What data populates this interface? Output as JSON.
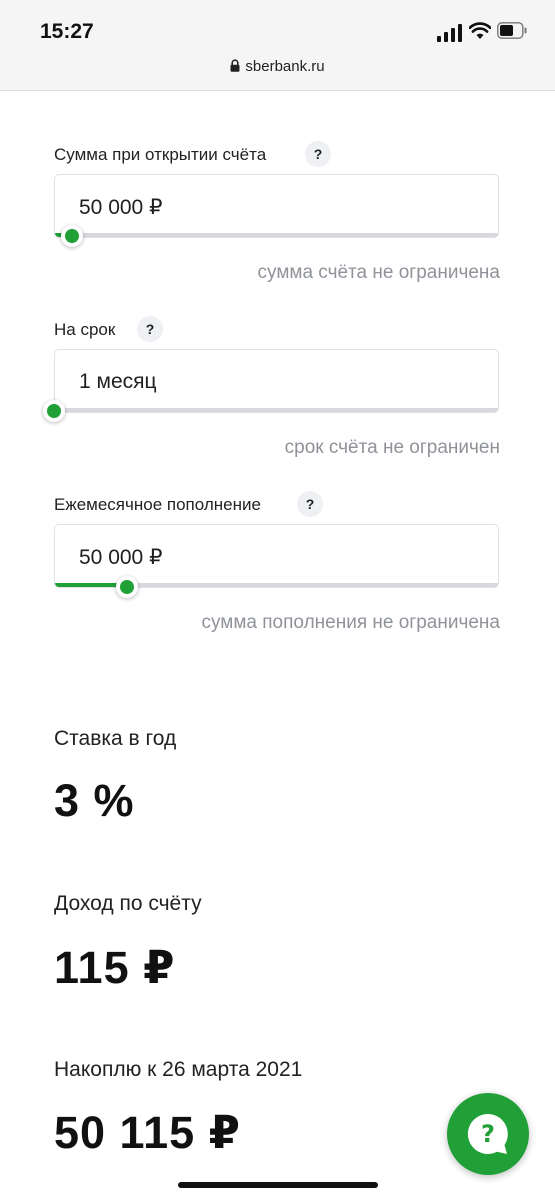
{
  "status_bar": {
    "time": "15:27",
    "url": "sberbank.ru"
  },
  "calculator": {
    "initial_amount": {
      "label": "Сумма при открытии счёта",
      "help": "?",
      "value": "50 000 ₽",
      "hint": "сумма счёта не ограничена",
      "slider_fraction": 0.04
    },
    "term": {
      "label": "На срок",
      "help": "?",
      "value": "1 месяц",
      "hint": "срок счёта не ограничен",
      "slider_fraction": 0.0
    },
    "monthly_topup": {
      "label": "Ежемесячное пополнение",
      "help": "?",
      "value": "50 000 ₽",
      "hint": "сумма пополнения не ограничена",
      "slider_fraction": 0.165
    }
  },
  "results": {
    "rate": {
      "label": "Ставка в год",
      "value": "3 %"
    },
    "income": {
      "label": "Доход по счёту",
      "value": "115 ₽"
    },
    "savings": {
      "label": "Накоплю к 26 марта 2021",
      "value": "50 115 ₽"
    }
  },
  "colors": {
    "accent": "#21a038",
    "hint_text": "#8f9399",
    "track": "#d7d9de"
  },
  "icons": {
    "chat": "chat-help-icon",
    "lock": "lock-icon"
  }
}
